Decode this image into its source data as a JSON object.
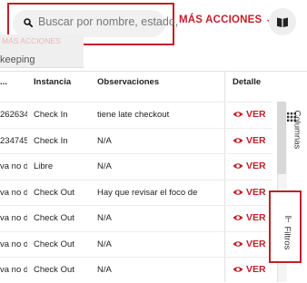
{
  "search": {
    "placeholder": "Buscar por nombre, estado,"
  },
  "header": {
    "more_actions_label": "MÁS ACCIONES",
    "more_actions_chevron": "⌄"
  },
  "ghost_tab": {
    "small_label": "MÁS ACCIONES",
    "main_label": "keeping"
  },
  "table": {
    "columns": {
      "id": "...",
      "instance": "Instancia",
      "observations": "Observaciones",
      "detail": "Detalle"
    },
    "detail_link_label": "VER",
    "rows": [
      {
        "id": "262634",
        "instance": "Check In",
        "observations": "tiene late checkout"
      },
      {
        "id": "234745",
        "instance": "Check In",
        "observations": "N/A"
      },
      {
        "id": "va no d",
        "instance": "Libre",
        "observations": "N/A"
      },
      {
        "id": "va no d",
        "instance": "Check Out",
        "observations": "Hay que revisar el foco de"
      },
      {
        "id": "va no d",
        "instance": "Check Out",
        "observations": "N/A"
      },
      {
        "id": "va no d",
        "instance": "Check Out",
        "observations": "N/A"
      },
      {
        "id": "va no d",
        "instance": "Check Out",
        "observations": "N/A"
      }
    ]
  },
  "side_panel": {
    "columns_label": "Columnas",
    "filters_label": "Filtros"
  },
  "colors": {
    "accent": "#c0202a",
    "pill": "#f1f1f1"
  },
  "icons": {
    "search": "search-icon",
    "book": "book-icon",
    "eye": "eye-icon",
    "grid": "grid-icon",
    "filter": "filter-icon"
  }
}
